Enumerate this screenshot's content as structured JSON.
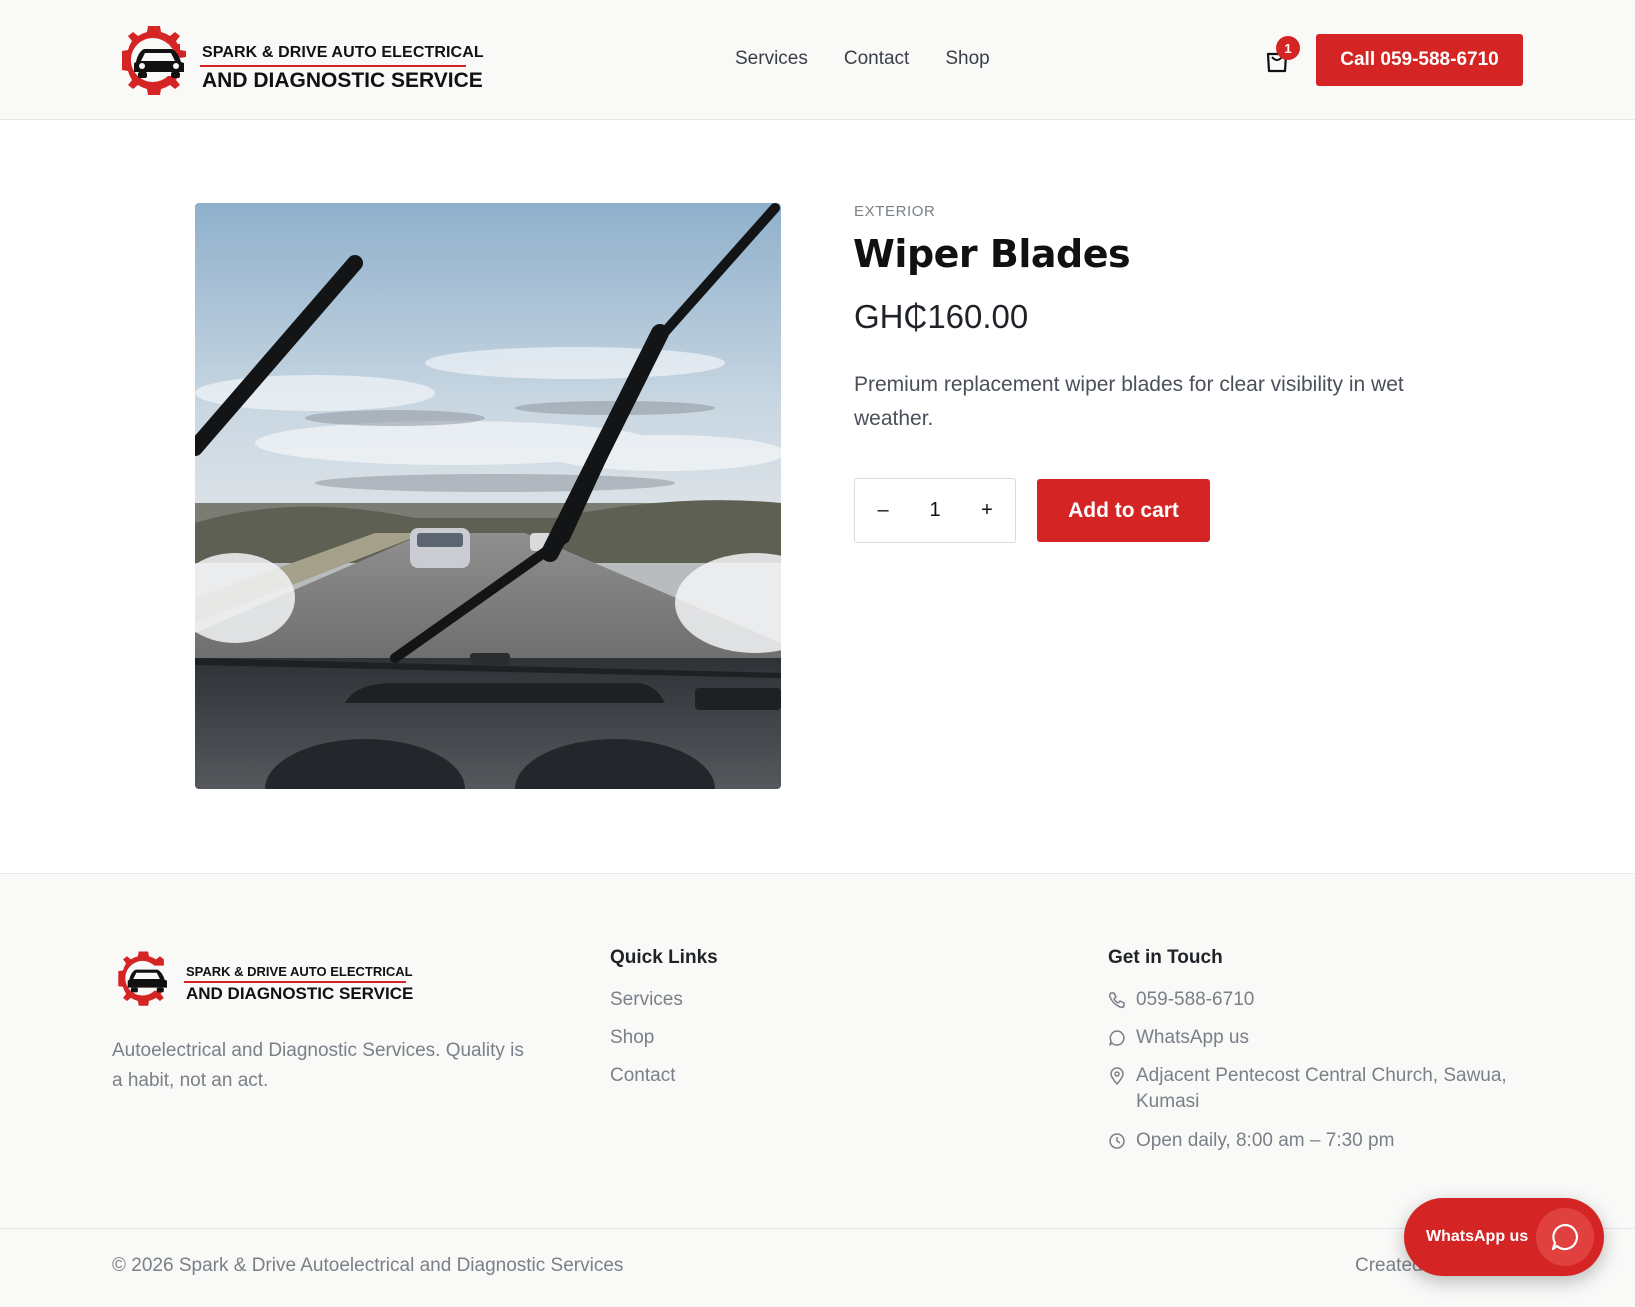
{
  "brand": {
    "line1": "SPARK & DRIVE AUTO ELECTRICAL",
    "line2": "AND DIAGNOSTIC SERVICE",
    "accent_color": "#d42424"
  },
  "nav": {
    "items": [
      {
        "label": "Services"
      },
      {
        "label": "Contact"
      },
      {
        "label": "Shop"
      }
    ]
  },
  "cart": {
    "icon": "shopping-bag-icon",
    "count": "1"
  },
  "call_button": {
    "label": "Call 059-588-6710"
  },
  "product": {
    "category": "EXTERIOR",
    "title": "Wiper Blades",
    "price": "GH₵160.00",
    "description": "Premium replacement wiper blades for clear visibility in wet weather.",
    "quantity": "1",
    "decrement_label": "–",
    "increment_label": "+",
    "add_to_cart_label": "Add to cart"
  },
  "footer": {
    "tagline": "Autoelectrical and Diagnostic Services. Quality is a habit, not an act.",
    "quick_links": {
      "heading": "Quick Links",
      "items": [
        "Services",
        "Shop",
        "Contact"
      ]
    },
    "get_in_touch": {
      "heading": "Get in Touch",
      "phone": "059-588-6710",
      "whatsapp": "WhatsApp us",
      "address": "Adjacent Pentecost Central Church, Sawua, Kumasi",
      "hours": "Open daily, 8:00 am – 7:30 pm"
    },
    "copyright": "© 2026 Spark & Drive Autoelectrical and Diagnostic Services",
    "created": "Created"
  },
  "whatsapp_float": {
    "label": "WhatsApp us",
    "icon": "chat-bubble-icon"
  }
}
